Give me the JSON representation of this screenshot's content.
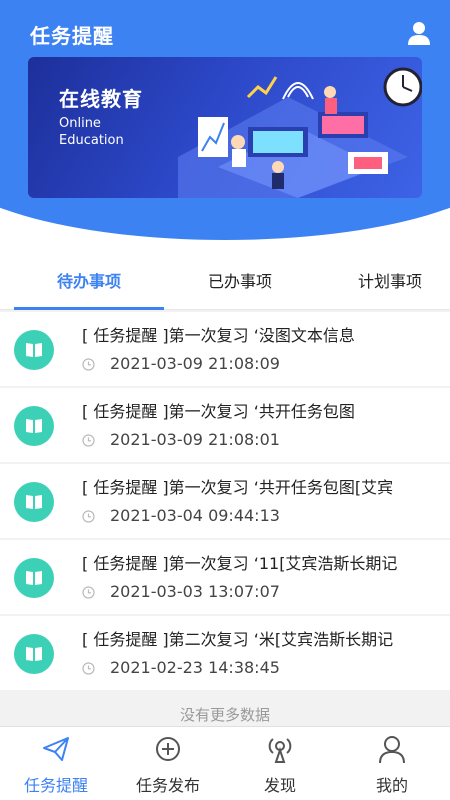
{
  "header": {
    "title": "任务提醒",
    "user_icon": "user-icon"
  },
  "banner": {
    "title": "在线教育",
    "subtitle": "Online Education"
  },
  "tabs": [
    {
      "label": "待办事项",
      "active": true
    },
    {
      "label": "已办事项",
      "active": false
    },
    {
      "label": "计划事项",
      "active": false
    }
  ],
  "tasks": [
    {
      "title": "[ 任务提醒 ]第一次复习 ‘没图文本信息",
      "time": "2021-03-09 21:08:09"
    },
    {
      "title": "[ 任务提醒 ]第一次复习 ‘共开任务包图",
      "time": "2021-03-09 21:08:01"
    },
    {
      "title": "[ 任务提醒 ]第一次复习 ‘共开任务包图[艾宾",
      "time": "2021-03-04 09:44:13"
    },
    {
      "title": "[ 任务提醒 ]第一次复习 ‘11[艾宾浩斯长期记",
      "time": "2021-03-03 13:07:07"
    },
    {
      "title": "[ 任务提醒 ]第二次复习 ‘米[艾宾浩斯长期记",
      "time": "2021-02-23 14:38:45"
    }
  ],
  "list_footer": "没有更多数据",
  "nav": [
    {
      "label": "任务提醒",
      "icon": "paper-plane-icon",
      "active": true
    },
    {
      "label": "任务发布",
      "icon": "plus-circle-icon",
      "active": false
    },
    {
      "label": "发现",
      "icon": "radar-icon",
      "active": false
    },
    {
      "label": "我的",
      "icon": "person-icon",
      "active": false
    }
  ],
  "colors": {
    "primary": "#3d82f2",
    "task_icon": "#3cd1b6"
  }
}
